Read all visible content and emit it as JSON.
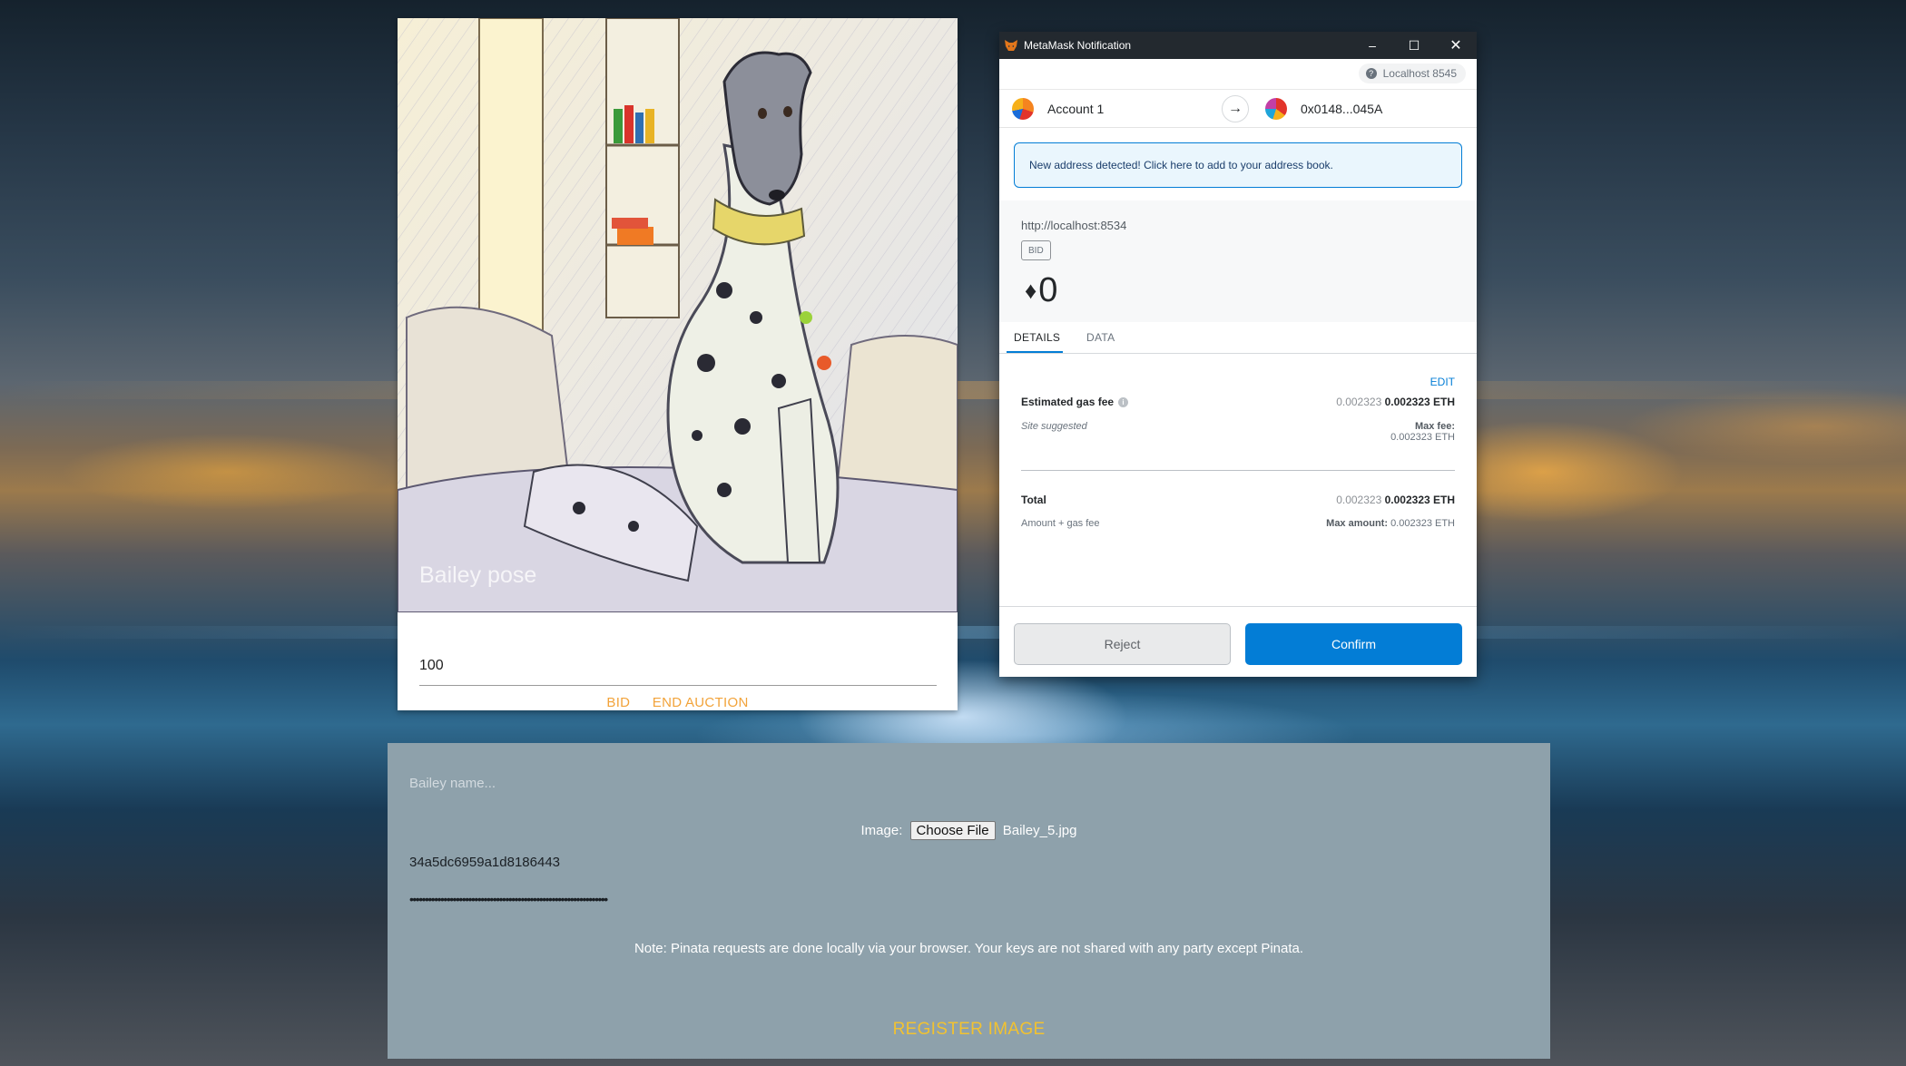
{
  "auction_card": {
    "image_caption": "Bailey pose",
    "bid_value": "100",
    "bid_label": "BID",
    "end_auction_label": "END AUCTION"
  },
  "metamask": {
    "window_title": "MetaMask Notification",
    "network": "Localhost 8545",
    "from_account": "Account 1",
    "to_address": "0x0148...045A",
    "notice": "New address detected! Click here to add to your address book.",
    "origin": "http://localhost:8534",
    "method": "BID",
    "eth_symbol": "♦",
    "amount": "0",
    "tabs": [
      "DETAILS",
      "DATA"
    ],
    "edit_label": "EDIT",
    "gas": {
      "label": "Estimated gas fee",
      "sub_label": "Site suggested",
      "value_secondary": "0.002323",
      "value_primary": "0.002323 ETH",
      "max_fee_label": "Max fee:",
      "max_fee_value": "0.002323 ETH"
    },
    "total": {
      "label": "Total",
      "sub_label": "Amount + gas fee",
      "value_secondary": "0.002323",
      "value_primary": "0.002323 ETH",
      "max_amount_label": "Max amount:",
      "max_amount_value": "0.002323 ETH"
    },
    "reject_label": "Reject",
    "confirm_label": "Confirm",
    "accent_color": "#037dd6"
  },
  "register_panel": {
    "name_placeholder": "Bailey name...",
    "image_label": "Image:",
    "choose_file_label": "Choose File",
    "file_name": "Bailey_5.jpg",
    "api_key": "34a5dc6959a1d8186443",
    "secret_masked": "••••••••••••••••••••••••••••••••••••••••••••••••••••••••••••••••",
    "note": "Note: Pinata requests are done locally via your browser. Your keys are not shared with any party except Pinata.",
    "register_label": "REGISTER IMAGE",
    "accent_color": "#f2c230"
  }
}
